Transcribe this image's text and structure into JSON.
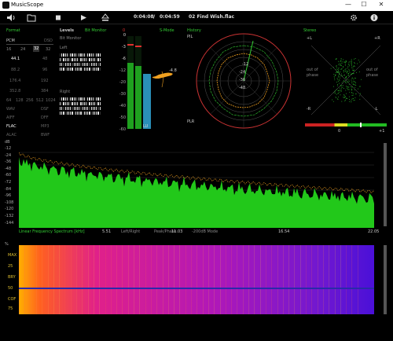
{
  "app": {
    "title": "MusicScope"
  },
  "window": {
    "min": "—",
    "max": "☐",
    "close": "✕"
  },
  "toolbar": {
    "time_pos": "0:04:08",
    "sep": "/",
    "time_total": "0:04:59",
    "file": "02 Find Wish.flac"
  },
  "format": {
    "title": "Format",
    "pcm": "PCM",
    "dsd": "DSD",
    "bits": [
      "16",
      "24",
      "32"
    ],
    "rates": [
      [
        "44.1",
        "48"
      ],
      [
        "88.2",
        "96"
      ],
      [
        "176.4",
        "192"
      ],
      [
        "352.8",
        "384"
      ]
    ],
    "dsd_rates": [
      "64",
      "128",
      "256",
      "512",
      "1024"
    ],
    "types": [
      [
        "WAV",
        "DSF"
      ],
      [
        "AIFF",
        "DFF"
      ],
      [
        "FLAC",
        "MP3"
      ],
      [
        "ALAC",
        "BWF"
      ]
    ]
  },
  "levels": {
    "title": "Levels",
    "bit_monitor": "Bit Monitor",
    "bit_monitor2": "Bit Monitor",
    "left": "Left",
    "right": "Right",
    "scale": [
      "0",
      "-3",
      "-6",
      "-12",
      "-20",
      "-30",
      "-40",
      "-50",
      "-60"
    ],
    "peak": "-4.8",
    "lu": "LU",
    "smode": "S-Mode",
    "zero": "0"
  },
  "history": {
    "title": "History",
    "pil": "PIL",
    "plr": "PLR",
    "rings": [
      "-12",
      "-24",
      "-36",
      "-48"
    ]
  },
  "stereo": {
    "title": "Stereo",
    "l": "+L",
    "r": "+R",
    "ml": "-L",
    "mr": "-R",
    "oop1": "out of phase",
    "oop2": "out of phase",
    "corr_min": "0",
    "corr_max": "+1"
  },
  "spectrum": {
    "unit": "dB",
    "yticks": [
      "-12",
      "-24",
      "-36",
      "-48",
      "-60",
      "-72",
      "-84",
      "-96",
      "-108",
      "-120",
      "-132",
      "-144"
    ],
    "mode": "Linear Frequency Spectrum [kHz]",
    "xticks": [
      "5.51",
      "11.03",
      "16.54",
      "22.05"
    ],
    "opts": [
      "Left/Right",
      "Peak/Phase",
      "-200dB Mode"
    ]
  },
  "spectrogram": {
    "pct": "%",
    "labels": [
      "MAX",
      "25",
      "BRY",
      "50",
      "COF",
      "75"
    ]
  },
  "colors": {
    "accent_green": "#33cc33",
    "peak_red": "#e03030",
    "orange": "#f0a020",
    "blue": "#2a8fb8"
  }
}
